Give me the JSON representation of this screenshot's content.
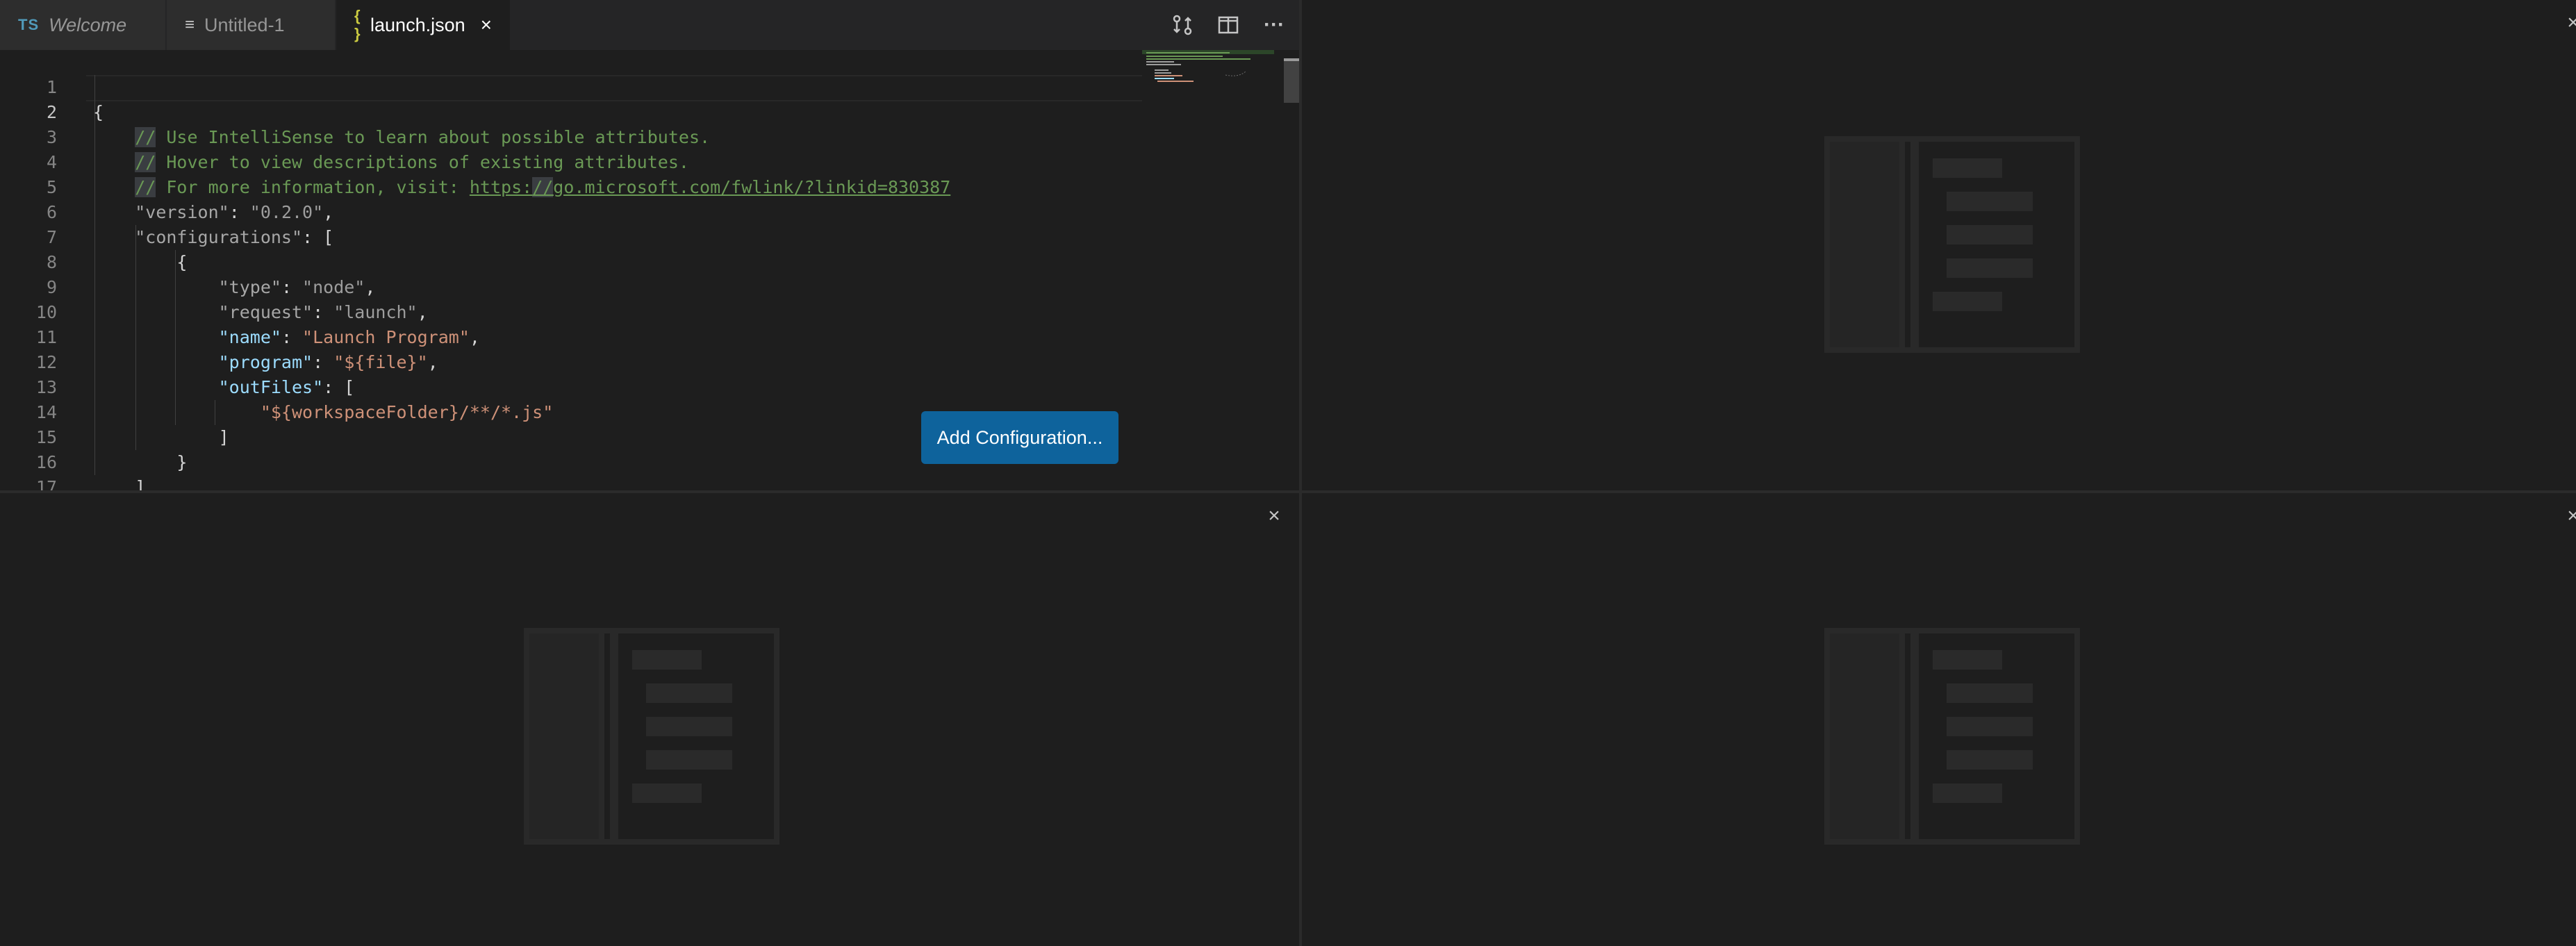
{
  "tabs": [
    {
      "badge": "TS",
      "label": "Welcome"
    },
    {
      "badge": "≡",
      "label": "Untitled-1"
    },
    {
      "badge": "{ }",
      "label": "launch.json"
    }
  ],
  "editor_actions": {
    "more": "···"
  },
  "code": {
    "line_numbers": [
      "1",
      "2",
      "3",
      "4",
      "5",
      "6",
      "7",
      "8",
      "9",
      "10",
      "11",
      "12",
      "13",
      "14",
      "15",
      "16",
      "17"
    ],
    "l1_brace": "{",
    "l2_slashes": "//",
    "l2_text": " Use IntelliSense to learn about possible attributes.",
    "l3_slashes": "//",
    "l3_text": " Hover to view descriptions of existing attributes.",
    "l4_slashes": "//",
    "l4_text": " For more information, visit: ",
    "l4_link_a": "https:",
    "l4_link_b": "//",
    "l4_link_c": "go.microsoft.com/fwlink/?linkid=830387",
    "l5_key": "\"version\"",
    "l5_val": "\"0.2.0\"",
    "l6_key": "\"configurations\"",
    "l6_brk": "[",
    "l7_brace": "{",
    "l8_key": "\"type\"",
    "l8_val": "\"node\"",
    "l9_key": "\"request\"",
    "l9_val": "\"launch\"",
    "l10_key": "\"name\"",
    "l10_val": "\"Launch Program\"",
    "l11_key": "\"program\"",
    "l11_val": "\"${file}\"",
    "l12_key": "\"outFiles\"",
    "l12_brk": "[",
    "l13_val": "\"${workspaceFolder}/**/*.js\"",
    "l14_brk": "]",
    "l15_brace": "}",
    "l16_brk": "]",
    "l17_brace": "}"
  },
  "add_configuration_label": "Add Configuration...",
  "group_close": "×",
  "colors": {
    "accent_button": "#0e639c",
    "editor_bg": "#1e1e1e",
    "comment": "#6a9955",
    "string": "#ce9178",
    "key": "#9cdcfe"
  }
}
